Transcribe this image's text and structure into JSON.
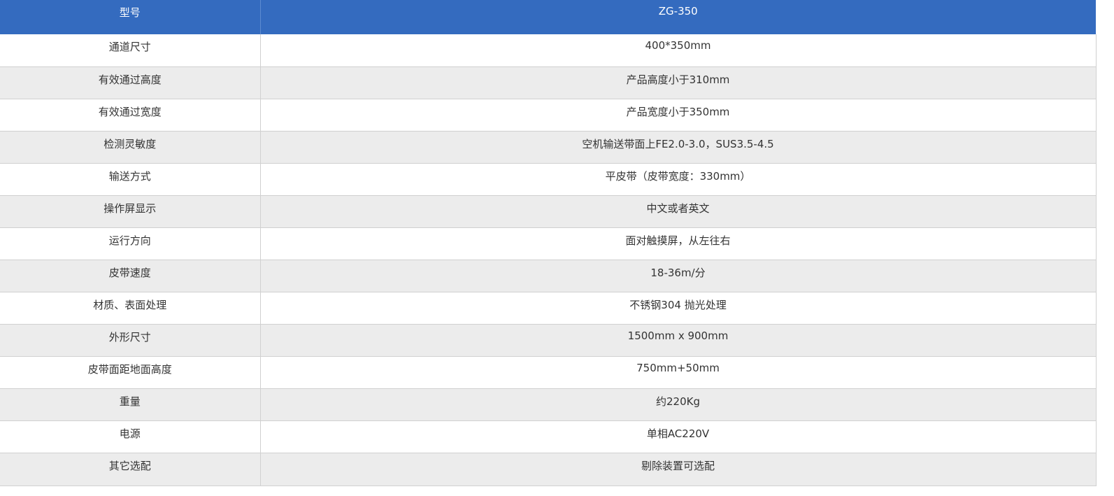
{
  "header": {
    "label": "型号",
    "value": "ZG-350"
  },
  "colors": {
    "header_bg": "#346bbf",
    "row_alt_bg": "#ececec",
    "text": "#333333"
  },
  "rows": [
    {
      "label": "通道尺寸",
      "value": "400*350mm"
    },
    {
      "label": "有效通过高度",
      "value": "产品高度小于310mm"
    },
    {
      "label": "有效通过宽度",
      "value": "产品宽度小于350mm"
    },
    {
      "label": "检测灵敏度",
      "value": "空机输送带面上FE2.0-3.0，SUS3.5-4.5"
    },
    {
      "label": "输送方式",
      "value": "平皮带（皮带宽度：330mm）"
    },
    {
      "label": "操作屏显示",
      "value": "中文或者英文"
    },
    {
      "label": "运行方向",
      "value": "面对触摸屏，从左往右"
    },
    {
      "label": "皮带速度",
      "value": "18-36m/分"
    },
    {
      "label": "材质、表面处理",
      "value": "不锈钢304 抛光处理"
    },
    {
      "label": "外形尺寸",
      "value": "1500mm x 900mm"
    },
    {
      "label": "皮带面距地面高度",
      "value": "750mm+50mm"
    },
    {
      "label": "重量",
      "value": "约220Kg"
    },
    {
      "label": "电源",
      "value": "单相AC220V"
    },
    {
      "label": "其它选配",
      "value": "剔除装置可选配"
    }
  ]
}
